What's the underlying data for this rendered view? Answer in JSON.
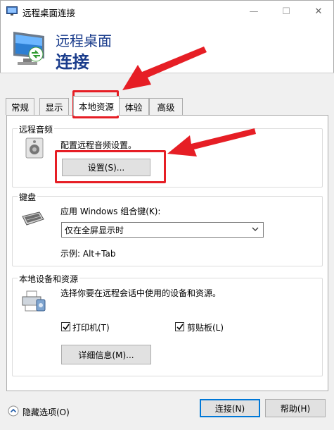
{
  "window": {
    "title": "远程桌面连接",
    "min_glyph": "—",
    "max_glyph": "☐",
    "close_glyph": "✕"
  },
  "banner": {
    "line1": "远程桌面",
    "line2": "连接"
  },
  "tabs": [
    {
      "label": "常规"
    },
    {
      "label": "显示"
    },
    {
      "label": "本地资源"
    },
    {
      "label": "体验"
    },
    {
      "label": "高级"
    }
  ],
  "audio": {
    "legend": "远程音频",
    "description": "配置远程音频设置。",
    "button": "设置(S)..."
  },
  "keyboard": {
    "legend": "键盘",
    "label": "应用 Windows 组合键(K):",
    "selected": "仅在全屏显示时",
    "example": "示例: Alt+Tab"
  },
  "devices": {
    "legend": "本地设备和资源",
    "description": "选择你要在远程会话中使用的设备和资源。",
    "printers": "打印机(T)",
    "clipboard": "剪贴板(L)",
    "more_button": "详细信息(M)...",
    "printers_checked": true,
    "clipboard_checked": true
  },
  "footer": {
    "hide_options": "隐藏选项(O)",
    "connect": "连接(N)",
    "help": "帮助(H)"
  },
  "colors": {
    "accent": "#0078d7",
    "annotation_red": "#e61e25",
    "banner_text": "#1a3c8c"
  }
}
